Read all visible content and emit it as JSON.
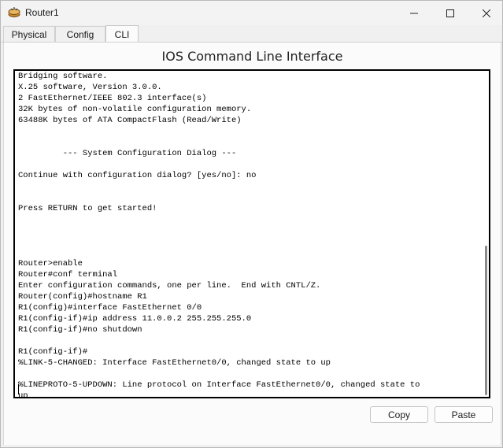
{
  "window": {
    "title": "Router1",
    "icon": "router-icon",
    "controls": [
      "minimize-icon",
      "maximize-icon",
      "close-icon"
    ]
  },
  "tabs": [
    {
      "label": "Physical",
      "active": false
    },
    {
      "label": "Config",
      "active": false
    },
    {
      "label": "CLI",
      "active": true
    }
  ],
  "panel": {
    "title": "IOS Command Line Interface"
  },
  "terminal": {
    "text": "Bridging software.\nX.25 software, Version 3.0.0.\n2 FastEthernet/IEEE 802.3 interface(s)\n32K bytes of non-volatile configuration memory.\n63488K bytes of ATA CompactFlash (Read/Write)\n\n\n         --- System Configuration Dialog ---\n\nContinue with configuration dialog? [yes/no]: no\n\n\nPress RETURN to get started!\n\n\n\n\nRouter>enable\nRouter#conf terminal\nEnter configuration commands, one per line.  End with CNTL/Z.\nRouter(config)#hostname R1\nR1(config)#interface FastEthernet 0/0\nR1(config-if)#ip address 11.0.0.2 255.255.255.0\nR1(config-if)#no shutdown\n\nR1(config-if)#\n%LINK-5-CHANGED: Interface FastEthernet0/0, changed state to up\n\n%LINEPROTO-5-UPDOWN: Line protocol on Interface FastEthernet0/0, changed state to\nup"
  },
  "buttons": {
    "copy": "Copy",
    "paste": "Paste"
  }
}
